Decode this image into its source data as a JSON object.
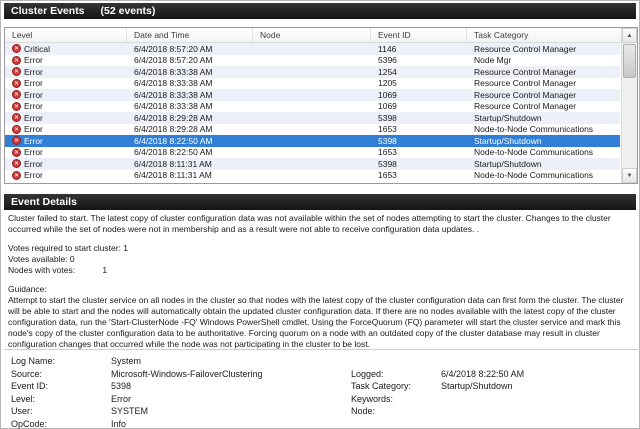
{
  "title_bar": {
    "title": "Cluster Events",
    "count": "(52 events)"
  },
  "colors": {
    "header_bar": "#1a1a1a",
    "selected_row": "#2f7fd6",
    "row_stripe": "#eef0f9",
    "error_icon": "#cf3a3a"
  },
  "table": {
    "columns": [
      "Level",
      "Date and Time",
      "Node",
      "Event ID",
      "Task Category"
    ],
    "rows": [
      {
        "level": "Critical",
        "datetime": "6/4/2018 8:57:20 AM",
        "node": "",
        "event_id": "1146",
        "task_category": "Resource Control Manager",
        "selected": false
      },
      {
        "level": "Error",
        "datetime": "6/4/2018 8:57:20 AM",
        "node": "",
        "event_id": "5396",
        "task_category": "Node Mgr",
        "selected": false
      },
      {
        "level": "Error",
        "datetime": "6/4/2018 8:33:38 AM",
        "node": "",
        "event_id": "1254",
        "task_category": "Resource Control Manager",
        "selected": false
      },
      {
        "level": "Error",
        "datetime": "6/4/2018 8:33:38 AM",
        "node": "",
        "event_id": "1205",
        "task_category": "Resource Control Manager",
        "selected": false
      },
      {
        "level": "Error",
        "datetime": "6/4/2018 8:33:38 AM",
        "node": "",
        "event_id": "1069",
        "task_category": "Resource Control Manager",
        "selected": false
      },
      {
        "level": "Error",
        "datetime": "6/4/2018 8:33:38 AM",
        "node": "",
        "event_id": "1069",
        "task_category": "Resource Control Manager",
        "selected": false
      },
      {
        "level": "Error",
        "datetime": "6/4/2018 8:29:28 AM",
        "node": "",
        "event_id": "5398",
        "task_category": "Startup/Shutdown",
        "selected": false
      },
      {
        "level": "Error",
        "datetime": "6/4/2018 8:29:28 AM",
        "node": "",
        "event_id": "1653",
        "task_category": "Node-to-Node Communications",
        "selected": false
      },
      {
        "level": "Error",
        "datetime": "6/4/2018 8:22:50 AM",
        "node": "",
        "event_id": "5398",
        "task_category": "Startup/Shutdown",
        "selected": true
      },
      {
        "level": "Error",
        "datetime": "6/4/2018 8:22:50 AM",
        "node": "",
        "event_id": "1653",
        "task_category": "Node-to-Node Communications",
        "selected": false
      },
      {
        "level": "Error",
        "datetime": "6/4/2018 8:11:31 AM",
        "node": "",
        "event_id": "5398",
        "task_category": "Startup/Shutdown",
        "selected": false
      },
      {
        "level": "Error",
        "datetime": "6/4/2018 8:11:31 AM",
        "node": "",
        "event_id": "1653",
        "task_category": "Node-to-Node Communications",
        "selected": false
      }
    ]
  },
  "details": {
    "header": "Event Details",
    "description": "Cluster failed to start. The latest copy of cluster configuration data was not available within the set of nodes attempting to start the cluster. Changes to the cluster occurred while the set of nodes were not in membership and as a result were not able to receive configuration data updates. .",
    "votes": [
      {
        "label": "Votes required to start cluster:",
        "value": "1"
      },
      {
        "label": "Votes available:",
        "value": "0"
      },
      {
        "label": "Nodes with votes:",
        "value": "1"
      }
    ],
    "guidance_label": "Guidance:",
    "guidance": "Attempt to start the cluster service on all nodes in the cluster so that nodes with the latest copy of the cluster configuration data can first form the cluster. The cluster will be able to start and the nodes will automatically obtain the updated cluster configuration data. If there are no nodes available with the latest copy of the cluster configuration data, run the 'Start-ClusterNode -FQ' Windows PowerShell cmdlet. Using the ForceQuorum (FQ) parameter will start the cluster service and mark this node's copy of the cluster configuration data to be authoritative.  Forcing quorum on a node with an outdated copy of the cluster database may result in cluster configuration changes that occurred while the node was not participating in the cluster to be lost."
  },
  "fields": {
    "left": [
      {
        "label": "Log Name:",
        "value": "System"
      },
      {
        "label": "Source:",
        "value": "Microsoft-Windows-FailoverClustering"
      },
      {
        "label": "Event ID:",
        "value": "5398"
      },
      {
        "label": "Level:",
        "value": "Error"
      },
      {
        "label": "User:",
        "value": "SYSTEM"
      },
      {
        "label": "OpCode:",
        "value": "Info"
      }
    ],
    "right": [
      {
        "label": "",
        "value": ""
      },
      {
        "label": "Logged:",
        "value": "6/4/2018 8:22:50 AM"
      },
      {
        "label": "Task Category:",
        "value": "Startup/Shutdown"
      },
      {
        "label": "Keywords:",
        "value": ""
      },
      {
        "label": "Node:",
        "value": ""
      },
      {
        "label": "",
        "value": ""
      }
    ]
  }
}
